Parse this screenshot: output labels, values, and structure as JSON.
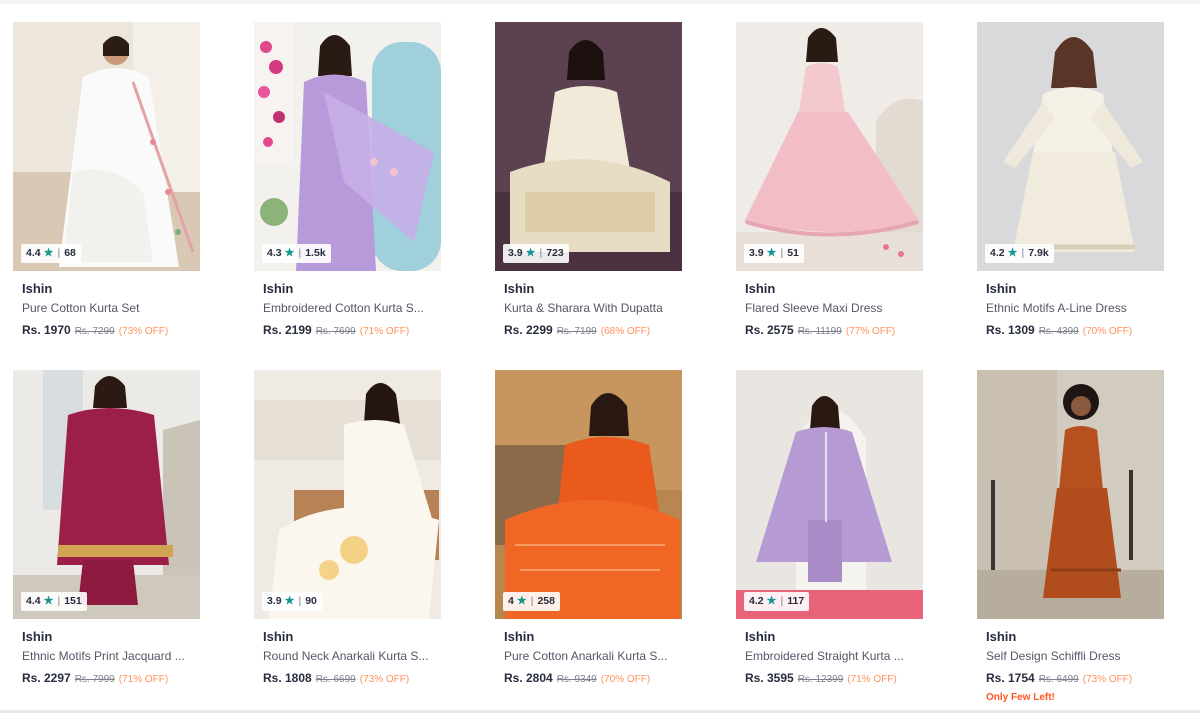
{
  "colors": {
    "rating_star": "#14958f",
    "discount": "#ff905a",
    "stock_alert": "#ff5722",
    "text_primary": "#282c3f"
  },
  "products": [
    {
      "brand": "Ishin",
      "name": "Pure Cotton Kurta Set",
      "rating": "4.4",
      "reviews": "68",
      "price": "Rs. 1970",
      "mrp": "Rs. 7299",
      "discount": "(73% OFF)"
    },
    {
      "brand": "Ishin",
      "name": "Embroidered Cotton Kurta S...",
      "rating": "4.3",
      "reviews": "1.5k",
      "price": "Rs. 2199",
      "mrp": "Rs. 7699",
      "discount": "(71% OFF)"
    },
    {
      "brand": "Ishin",
      "name": "Kurta & Sharara With Dupatta",
      "rating": "3.9",
      "reviews": "723",
      "price": "Rs. 2299",
      "mrp": "Rs. 7199",
      "discount": "(68% OFF)"
    },
    {
      "brand": "Ishin",
      "name": "Flared Sleeve Maxi Dress",
      "rating": "3.9",
      "reviews": "51",
      "price": "Rs. 2575",
      "mrp": "Rs. 11199",
      "discount": "(77% OFF)"
    },
    {
      "brand": "Ishin",
      "name": "Ethnic Motifs A-Line Dress",
      "rating": "4.2",
      "reviews": "7.9k",
      "price": "Rs. 1309",
      "mrp": "Rs. 4399",
      "discount": "(70% OFF)"
    },
    {
      "brand": "Ishin",
      "name": "Ethnic Motifs Print Jacquard ...",
      "rating": "4.4",
      "reviews": "151",
      "price": "Rs. 2297",
      "mrp": "Rs. 7999",
      "discount": "(71% OFF)"
    },
    {
      "brand": "Ishin",
      "name": "Round Neck Anarkali Kurta S...",
      "rating": "3.9",
      "reviews": "90",
      "price": "Rs. 1808",
      "mrp": "Rs. 6699",
      "discount": "(73% OFF)"
    },
    {
      "brand": "Ishin",
      "name": "Pure Cotton Anarkali Kurta S...",
      "rating": "4",
      "reviews": "258",
      "price": "Rs. 2804",
      "mrp": "Rs. 9349",
      "discount": "(70% OFF)"
    },
    {
      "brand": "Ishin",
      "name": "Embroidered Straight Kurta ...",
      "rating": "4.2",
      "reviews": "117",
      "price": "Rs. 3595",
      "mrp": "Rs. 12399",
      "discount": "(71% OFF)"
    },
    {
      "brand": "Ishin",
      "name": "Self Design Schiffli Dress",
      "rating": "",
      "reviews": "",
      "price": "Rs. 1754",
      "mrp": "Rs. 6499",
      "discount": "(73% OFF)",
      "stock_note": "Only Few Left!"
    }
  ]
}
